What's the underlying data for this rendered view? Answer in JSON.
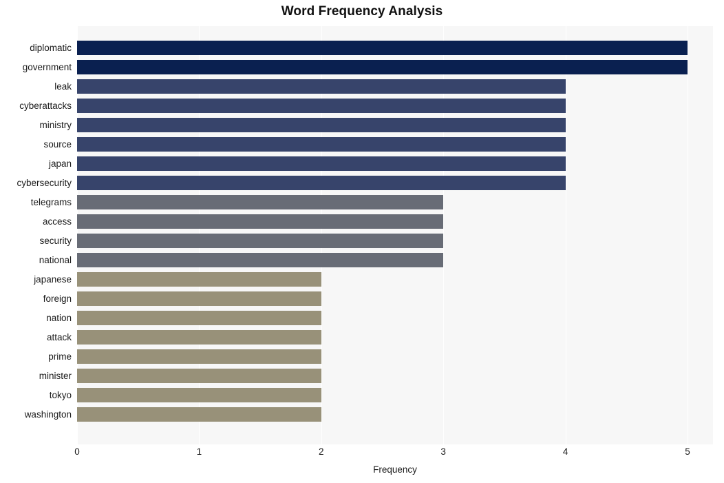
{
  "chart_data": {
    "type": "bar",
    "orientation": "horizontal",
    "title": "Word Frequency Analysis",
    "xlabel": "Frequency",
    "ylabel": "",
    "xlim": [
      0,
      5
    ],
    "xticks": [
      "0",
      "1",
      "2",
      "3",
      "4",
      "5"
    ],
    "grid": true,
    "legend": null,
    "categories": [
      "diplomatic",
      "government",
      "leak",
      "cyberattacks",
      "ministry",
      "source",
      "japan",
      "cybersecurity",
      "telegrams",
      "access",
      "security",
      "national",
      "japanese",
      "foreign",
      "nation",
      "attack",
      "prime",
      "minister",
      "tokyo",
      "washington"
    ],
    "values": [
      5,
      5,
      4,
      4,
      4,
      4,
      4,
      4,
      3,
      3,
      3,
      3,
      2,
      2,
      2,
      2,
      2,
      2,
      2,
      2
    ],
    "bar_colors": [
      "#0a2050",
      "#0a2050",
      "#37446b",
      "#37446b",
      "#37446b",
      "#37446b",
      "#37446b",
      "#37446b",
      "#686c76",
      "#686c76",
      "#686c76",
      "#686c76",
      "#989179",
      "#989179",
      "#989179",
      "#989179",
      "#989179",
      "#989179",
      "#989179",
      "#989179"
    ]
  },
  "style": {
    "plot_background": "#f7f7f7",
    "figure_background": "#ffffff",
    "gridline_color": "#ffffff",
    "text_color": "#1a1a1a",
    "title_color": "#111111"
  }
}
